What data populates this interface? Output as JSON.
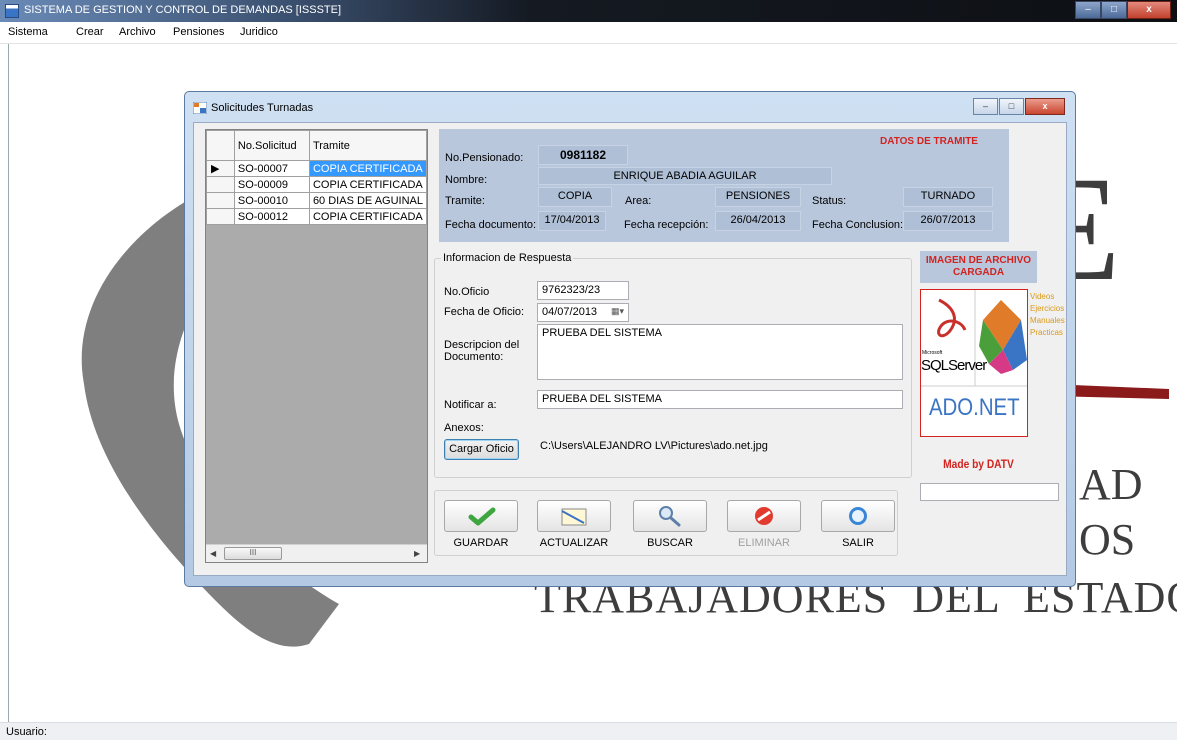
{
  "window": {
    "title": "SISTEMA DE GESTION Y CONTROL DE DEMANDAS [ISSSTE]",
    "minimize": "–",
    "maximize": "□",
    "close": "x"
  },
  "menu": [
    "Sistema",
    "Crear",
    "Archivo",
    "Pensiones",
    "Juridico"
  ],
  "status": {
    "usuario_label": "Usuario:"
  },
  "watermark": {
    "line1": "AD",
    "line2": "OS",
    "line3": "TRABAJADORES  DEL  ESTADO",
    "letter": "E"
  },
  "child": {
    "title": "Solicitudes Turnadas",
    "grid": {
      "columns": [
        "No.Solicitud",
        "Tramite"
      ],
      "rows": [
        {
          "solicitud": "SO-00007",
          "tramite": "COPIA CERTIFICADA",
          "current": true
        },
        {
          "solicitud": "SO-00009",
          "tramite": "COPIA CERTIFICADA",
          "current": false
        },
        {
          "solicitud": "SO-00010",
          "tramite": "60 DIAS DE AGUINAL",
          "current": false
        },
        {
          "solicitud": "SO-00012",
          "tramite": "COPIA CERTIFICADA",
          "current": false
        }
      ],
      "scroll_grip": "III"
    },
    "datos": {
      "header": "DATOS DE TRAMITE",
      "pensionado_label": "No.Pensionado:",
      "pensionado": "0981182",
      "nombre_label": "Nombre:",
      "nombre": "ENRIQUE ABADIA AGUILAR",
      "tramite_label": "Tramite:",
      "tramite": "COPIA",
      "area_label": "Area:",
      "area": "PENSIONES",
      "status_label": "Status:",
      "status": "TURNADO",
      "fecha_doc_label": "Fecha documento:",
      "fecha_doc": "17/04/2013",
      "fecha_rec_label": "Fecha recepción:",
      "fecha_rec": "26/04/2013",
      "fecha_con_label": "Fecha Conclusion:",
      "fecha_con": "26/07/2013"
    },
    "respuesta": {
      "group_title": "Informacion de Respuesta",
      "oficio_label": "No.Oficio",
      "oficio": "9762323/23",
      "fecha_label": "Fecha de Oficio:",
      "fecha": "04/07/2013",
      "descripcion_label": "Descripcion del Documento:",
      "descripcion": "PRUEBA DEL SISTEMA",
      "notificar_label": "Notificar a:",
      "notificar": "PRUEBA DEL SISTEMA",
      "anexos_label": "Anexos:",
      "cargar_button": "Cargar Oficio",
      "archivo": "C:\\Users\\ALEJANDRO LV\\Pictures\\ado.net.jpg"
    },
    "imagen": {
      "header": "IMAGEN DE ARCHIVO CARGADA",
      "sql_label": "SQLServer",
      "ms_label": "Microsoft",
      "side_list": [
        "Videos",
        "Ejercicios",
        "Manuales",
        "Practicas"
      ],
      "ado_label": "ADO.NET",
      "made_by": "Made by DATV"
    },
    "toolbar": {
      "guardar": "GUARDAR",
      "actualizar": "ACTUALIZAR",
      "buscar": "BUSCAR",
      "eliminar": "ELIMINAR",
      "salir": "SALIR"
    }
  },
  "colors": {
    "accent_red": "#d2231f",
    "panel_blue": "#b9c7dd",
    "selection": "#3399ff"
  }
}
